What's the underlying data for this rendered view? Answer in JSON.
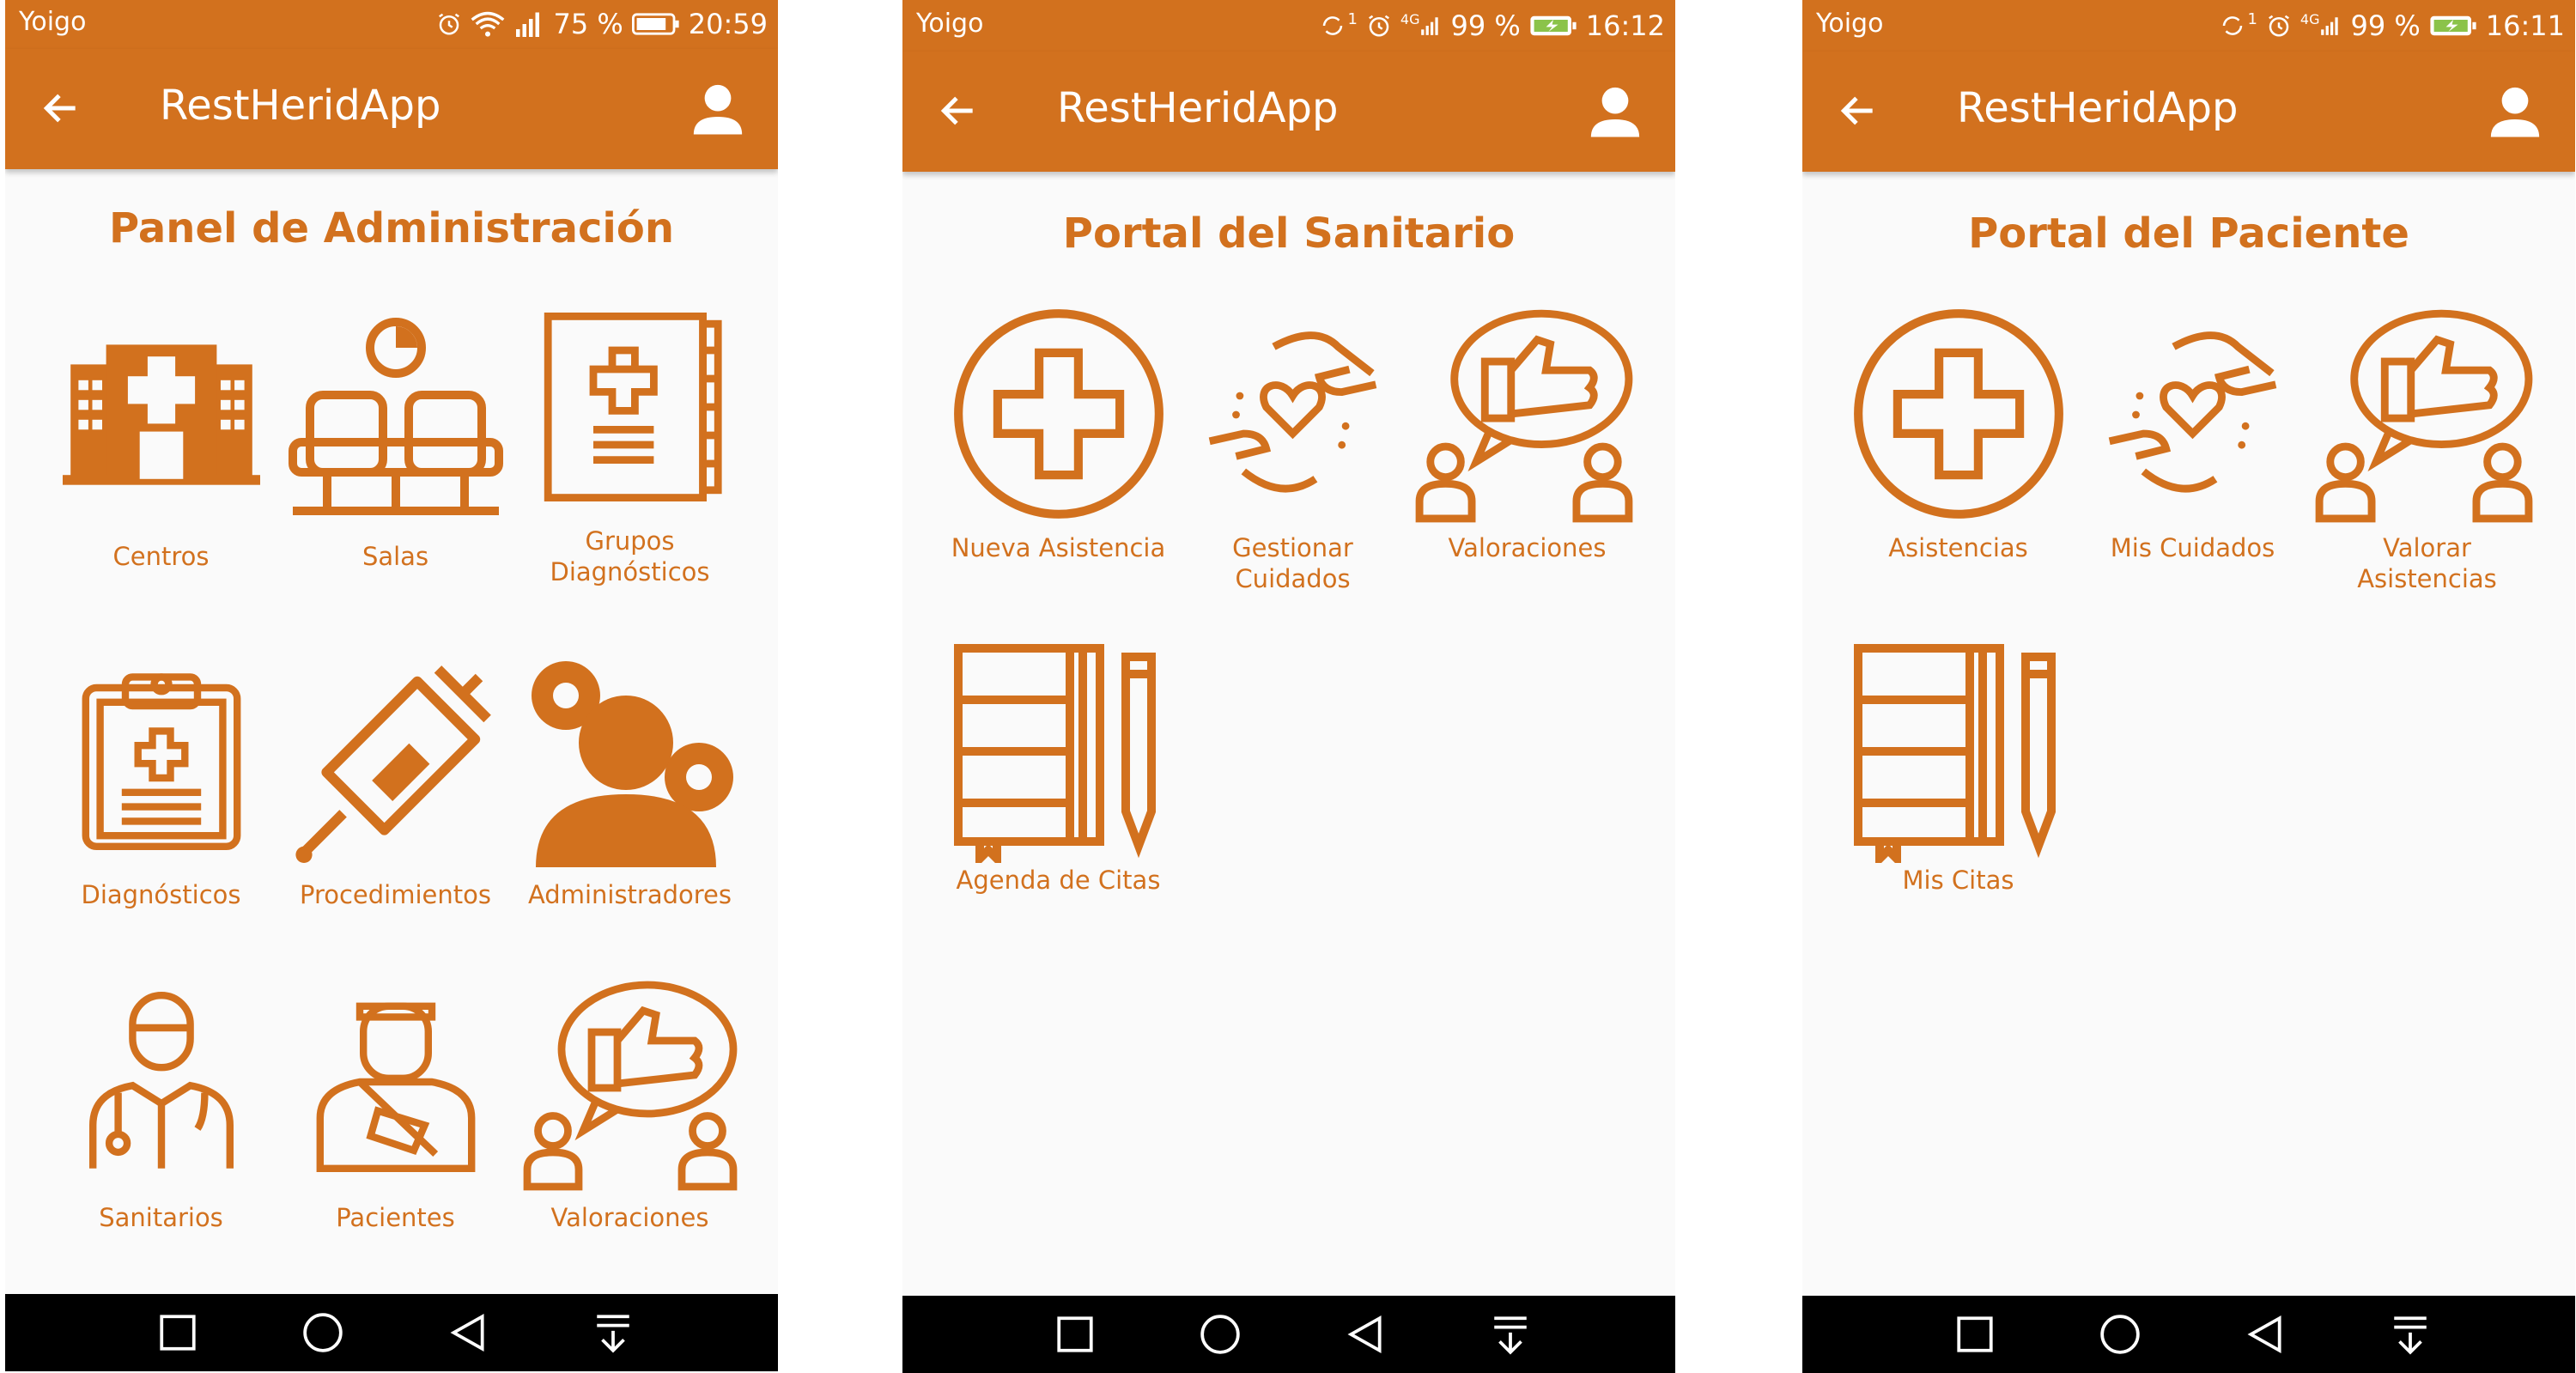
{
  "screens": [
    {
      "status": {
        "carrier": "Yoigo",
        "battery": "75 %",
        "time": "20:59"
      },
      "app_title": "RestHeridApp",
      "portal_title": "Panel de Administración",
      "items": [
        {
          "label": "Centros",
          "icon": "hospital-building-icon"
        },
        {
          "label": "Salas",
          "icon": "waiting-room-seats-icon"
        },
        {
          "label": "Grupos Diagnósticos",
          "icon": "medical-book-icon"
        },
        {
          "label": "Diagnósticos",
          "icon": "medical-clipboard-icon"
        },
        {
          "label": "Procedimientos",
          "icon": "syringe-icon"
        },
        {
          "label": "Administradores",
          "icon": "admin-gears-icon"
        },
        {
          "label": "Sanitarios",
          "icon": "doctor-icon"
        },
        {
          "label": "Pacientes",
          "icon": "patient-icon"
        },
        {
          "label": "Valoraciones",
          "icon": "thumbs-up-feedback-icon"
        }
      ]
    },
    {
      "status": {
        "carrier": "Yoigo",
        "battery": "99 %",
        "time": "16:12",
        "network": "4G",
        "badge": "1"
      },
      "app_title": "RestHeridApp",
      "portal_title": "Portal del Sanitario",
      "items": [
        {
          "label": "Nueva Asistencia",
          "icon": "medical-cross-circle-icon"
        },
        {
          "label": "Gestionar Cuidados",
          "icon": "caring-hands-heart-icon"
        },
        {
          "label": "Valoraciones",
          "icon": "thumbs-up-feedback-icon"
        },
        {
          "label": "Agenda de Citas",
          "icon": "notebook-pencil-icon"
        }
      ]
    },
    {
      "status": {
        "carrier": "Yoigo",
        "battery": "99 %",
        "time": "16:11",
        "network": "4G",
        "badge": "1"
      },
      "app_title": "RestHeridApp",
      "portal_title": "Portal del Paciente",
      "items": [
        {
          "label": "Asistencias",
          "icon": "medical-cross-circle-icon"
        },
        {
          "label": "Mis Cuidados",
          "icon": "caring-hands-heart-icon"
        },
        {
          "label": "Valorar Asistencias",
          "icon": "thumbs-up-feedback-icon"
        },
        {
          "label": "Mis Citas",
          "icon": "notebook-pencil-icon"
        }
      ]
    }
  ],
  "nav_buttons": [
    "recent-apps-icon",
    "home-icon",
    "back-triangle-icon",
    "notification-pull-icon"
  ],
  "colors": {
    "accent": "#d2711e",
    "background": "#fafafa",
    "navbar": "#000000"
  }
}
